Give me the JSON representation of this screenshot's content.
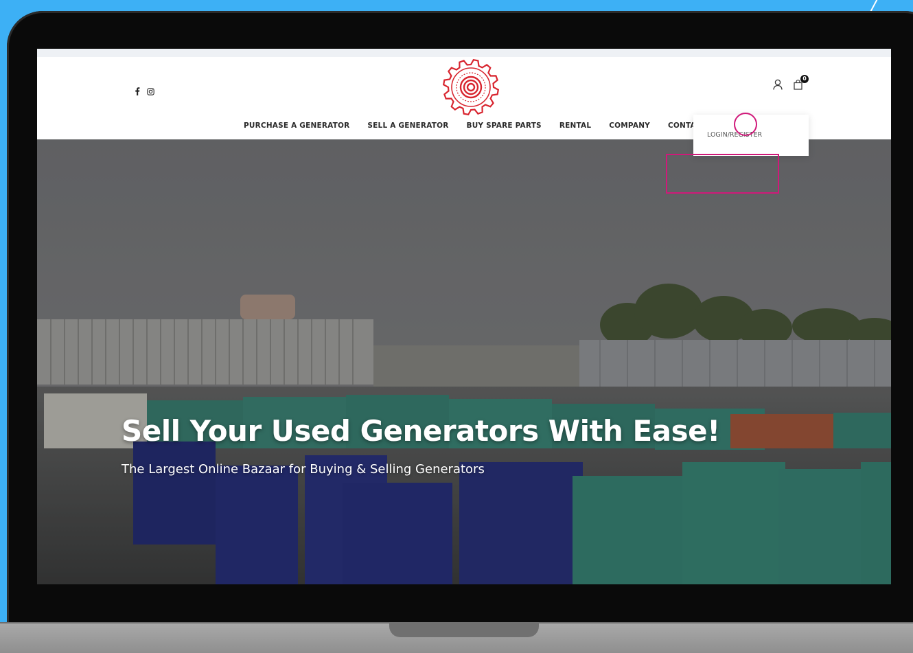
{
  "header": {
    "social": [
      {
        "icon": "facebook-icon"
      },
      {
        "icon": "instagram-icon"
      }
    ],
    "logo_icon": "gear-logo-icon",
    "account_icon": "user-icon",
    "cart_icon": "shopping-bag-icon",
    "cart_count": "0"
  },
  "nav": {
    "items": [
      {
        "label": "PURCHASE A GENERATOR"
      },
      {
        "label": "SELL A GENERATOR"
      },
      {
        "label": "BUY SPARE PARTS"
      },
      {
        "label": "RENTAL"
      },
      {
        "label": "COMPANY"
      },
      {
        "label": "CONTACT US"
      }
    ]
  },
  "account_menu": {
    "login_label": "LOGIN/REGISTER"
  },
  "hero": {
    "title": "Sell Your Used Generators With Ease!",
    "subtitle": "The Largest Online Bazaar for Buying & Selling Generators"
  },
  "colors": {
    "background": "#3db0f5",
    "annotation": "#d0197a",
    "logo": "#d8252f"
  }
}
